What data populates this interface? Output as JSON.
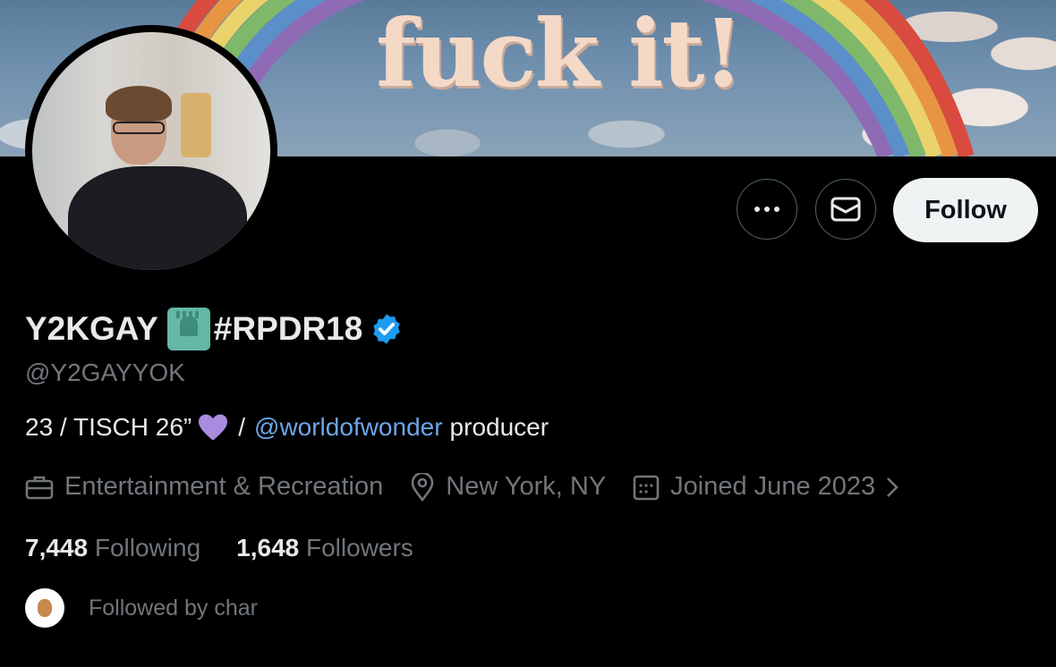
{
  "banner": {
    "text": "fuck it!"
  },
  "profile": {
    "display_name": "Y2KGAY",
    "name_suffix": "#RPDR18",
    "emoji_icon": "statue-of-liberty-icon",
    "handle": "@Y2GAYYOK",
    "bio_prefix": "23 / TISCH 26”",
    "bio_separator": "/",
    "bio_link": "@worldofwonder",
    "bio_suffix": "producer",
    "category": "Entertainment & Recreation",
    "location": "New York, NY",
    "joined": "Joined June 2023",
    "following_count": "7,448",
    "following_label": "Following",
    "followers_count": "1,648",
    "followers_label": "Followers",
    "followed_by": "Followed by char"
  },
  "actions": {
    "follow_label": "Follow"
  },
  "colors": {
    "background": "#000000",
    "link": "#6ea6e8",
    "verified": "#1d9bf0",
    "heart": "#a98ce0"
  }
}
